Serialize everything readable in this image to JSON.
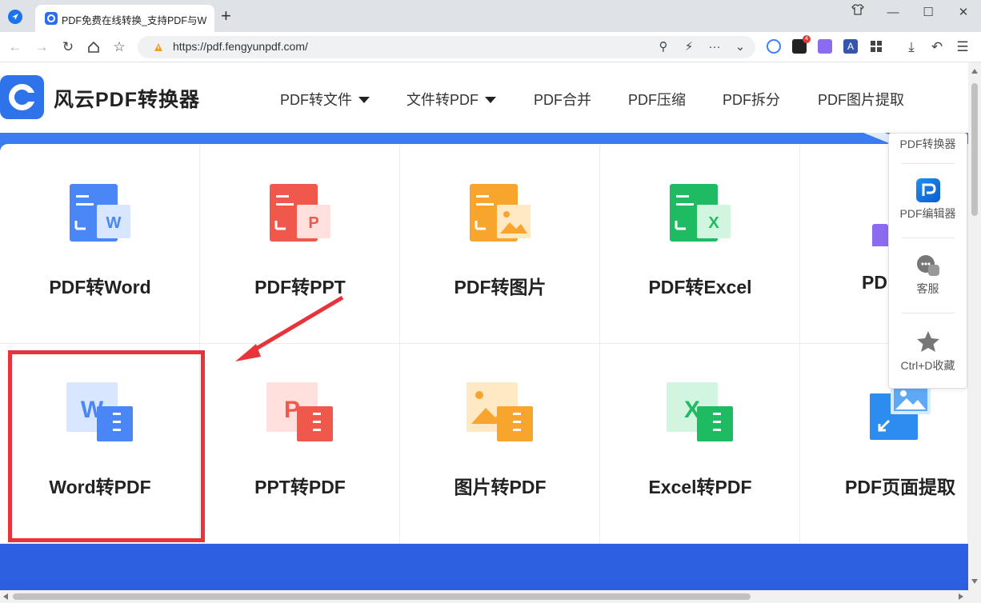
{
  "browser": {
    "tab_title": "PDF免费在线转换_支持PDF与W",
    "new_tab": "+",
    "url": "https://pdf.fengyunpdf.com/",
    "extension_badge": "4",
    "window": {
      "minimize": "—",
      "maximize": "☐",
      "close": "✕"
    }
  },
  "site": {
    "logo_text": "风云PDF转换器",
    "menu": [
      {
        "label": "PDF转文件",
        "dropdown": true
      },
      {
        "label": "文件转PDF",
        "dropdown": true
      },
      {
        "label": "PDF合并",
        "dropdown": false
      },
      {
        "label": "PDF压缩",
        "dropdown": false
      },
      {
        "label": "PDF拆分",
        "dropdown": false
      },
      {
        "label": "PDF图片提取",
        "dropdown": false
      }
    ]
  },
  "tools": {
    "row1": [
      {
        "label": "PDF转Word",
        "icon": "pdf-to-word-icon",
        "color": "#3d7bf1",
        "letter": "W"
      },
      {
        "label": "PDF转PPT",
        "icon": "pdf-to-ppt-icon",
        "color": "#f0574b",
        "letter": "P"
      },
      {
        "label": "PDF转图片",
        "icon": "pdf-to-image-icon",
        "color": "#f7a52d",
        "letter": ""
      },
      {
        "label": "PDF转Excel",
        "icon": "pdf-to-excel-icon",
        "color": "#1fbb62",
        "letter": "X"
      },
      {
        "label": "PD",
        "icon": "pdf-partial-icon",
        "color": "#8b6cf0",
        "letter": ""
      }
    ],
    "row2": [
      {
        "label": "Word转PDF",
        "icon": "word-to-pdf-icon",
        "color": "#3d7bf1",
        "letter": "W"
      },
      {
        "label": "PPT转PDF",
        "icon": "ppt-to-pdf-icon",
        "color": "#f0574b",
        "letter": "P"
      },
      {
        "label": "图片转PDF",
        "icon": "image-to-pdf-icon",
        "color": "#f7a52d",
        "letter": ""
      },
      {
        "label": "Excel转PDF",
        "icon": "excel-to-pdf-icon",
        "color": "#1fbb62",
        "letter": "X"
      },
      {
        "label": "PDF页面提取",
        "icon": "pdf-page-extract-icon",
        "color": "#2d8cf0",
        "letter": ""
      }
    ]
  },
  "side_panel": {
    "items": [
      {
        "label": "PDF转换器",
        "icon": ""
      },
      {
        "label": "PDF编辑器",
        "icon": "pdf-editor-icon"
      },
      {
        "label": "客服",
        "icon": "chat-icon"
      },
      {
        "label": "Ctrl+D收藏",
        "icon": "star-icon"
      }
    ]
  },
  "colors": {
    "brand_blue": "#2f73ea",
    "highlight_red": "#e8333b"
  }
}
